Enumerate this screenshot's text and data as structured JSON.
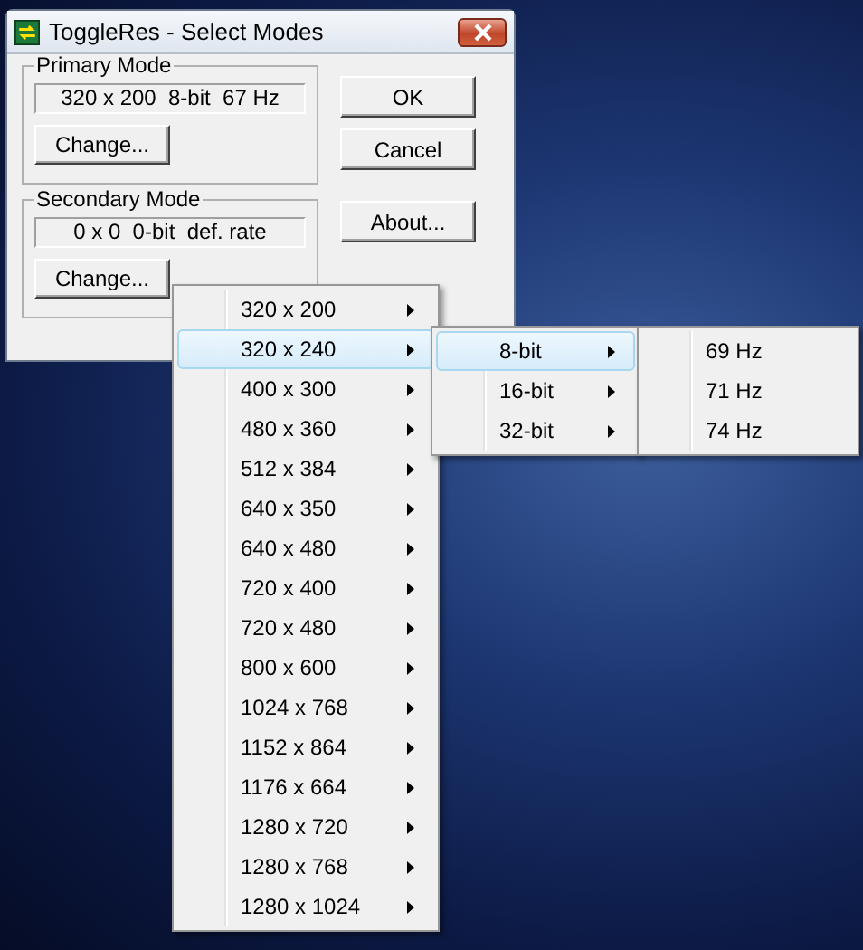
{
  "window": {
    "title": "ToggleRes - Select Modes"
  },
  "primary_mode": {
    "label": "Primary Mode",
    "value": "320 x 200  8-bit  67 Hz",
    "button": "Change..."
  },
  "secondary_mode": {
    "label": "Secondary Mode",
    "value": "0 x 0  0-bit  def. rate",
    "button": "Change..."
  },
  "buttons": [
    "OK",
    "Cancel",
    "About..."
  ],
  "menus": [
    {
      "items": [
        {
          "label": "320 x 200",
          "selected": false,
          "has_submenu": true
        },
        {
          "label": "320 x 240",
          "selected": true,
          "has_submenu": true
        },
        {
          "label": "400 x 300",
          "selected": false,
          "has_submenu": true
        },
        {
          "label": "480 x 360",
          "selected": false,
          "has_submenu": true
        },
        {
          "label": "512 x 384",
          "selected": false,
          "has_submenu": true
        },
        {
          "label": "640 x 350",
          "selected": false,
          "has_submenu": true
        },
        {
          "label": "640 x 480",
          "selected": false,
          "has_submenu": true
        },
        {
          "label": "720 x 400",
          "selected": false,
          "has_submenu": true
        },
        {
          "label": "720 x 480",
          "selected": false,
          "has_submenu": true
        },
        {
          "label": "800 x 600",
          "selected": false,
          "has_submenu": true
        },
        {
          "label": "1024 x 768",
          "selected": false,
          "has_submenu": true
        },
        {
          "label": "1152 x 864",
          "selected": false,
          "has_submenu": true
        },
        {
          "label": "1176 x 664",
          "selected": false,
          "has_submenu": true
        },
        {
          "label": "1280 x 720",
          "selected": false,
          "has_submenu": true
        },
        {
          "label": "1280 x 768",
          "selected": false,
          "has_submenu": true
        },
        {
          "label": "1280 x 1024",
          "selected": false,
          "has_submenu": true
        }
      ]
    },
    {
      "items": [
        {
          "label": "8-bit",
          "selected": true,
          "has_submenu": true
        },
        {
          "label": "16-bit",
          "selected": false,
          "has_submenu": true
        },
        {
          "label": "32-bit",
          "selected": false,
          "has_submenu": true
        }
      ]
    },
    {
      "items": [
        {
          "label": "69 Hz",
          "selected": false,
          "has_submenu": false
        },
        {
          "label": "71 Hz",
          "selected": false,
          "has_submenu": false
        },
        {
          "label": "74 Hz",
          "selected": false,
          "has_submenu": false
        }
      ]
    }
  ]
}
